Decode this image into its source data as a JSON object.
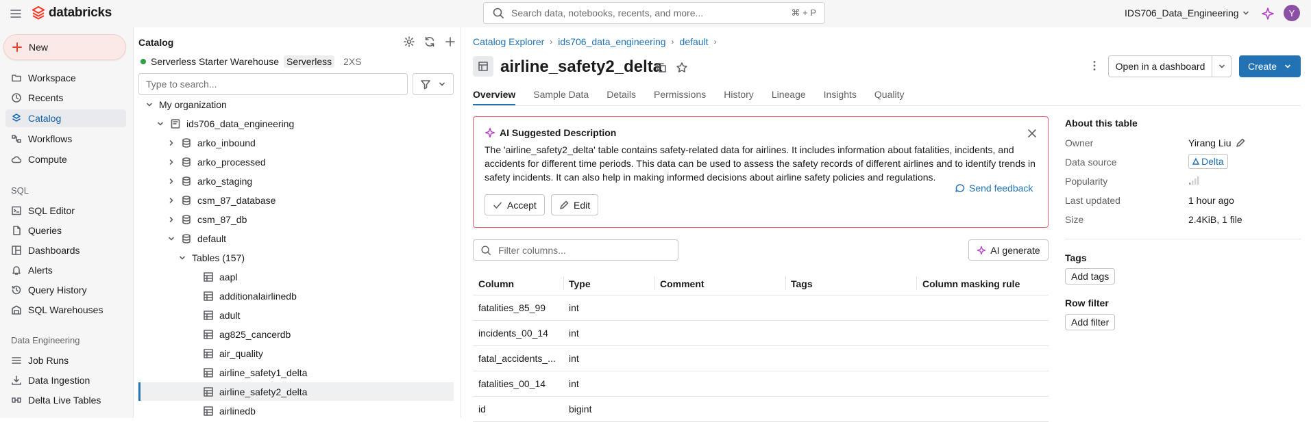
{
  "topbar": {
    "logo_text": "databricks",
    "search_placeholder": "Search data, notebooks, recents, and more...",
    "search_shortcut": "⌘ + P",
    "workspace_name": "IDS706_Data_Engineering",
    "avatar_initial": "Y"
  },
  "sidebar": {
    "new_label": "New",
    "items": [
      {
        "label": "Workspace",
        "icon": "folder-icon"
      },
      {
        "label": "Recents",
        "icon": "clock-icon"
      },
      {
        "label": "Catalog",
        "icon": "catalog-icon"
      },
      {
        "label": "Workflows",
        "icon": "workflows-icon"
      },
      {
        "label": "Compute",
        "icon": "cloud-icon"
      }
    ],
    "sql_section": "SQL",
    "sql_items": [
      {
        "label": "SQL Editor",
        "icon": "sql-editor-icon"
      },
      {
        "label": "Queries",
        "icon": "queries-icon"
      },
      {
        "label": "Dashboards",
        "icon": "dashboards-icon"
      },
      {
        "label": "Alerts",
        "icon": "bell-icon"
      },
      {
        "label": "Query History",
        "icon": "history-icon"
      },
      {
        "label": "SQL Warehouses",
        "icon": "warehouse-icon"
      }
    ],
    "de_section": "Data Engineering",
    "de_items": [
      {
        "label": "Job Runs",
        "icon": "job-runs-icon"
      },
      {
        "label": "Data Ingestion",
        "icon": "ingestion-icon"
      },
      {
        "label": "Delta Live Tables",
        "icon": "pipeline-icon"
      }
    ]
  },
  "catalog": {
    "title": "Catalog",
    "warehouse": "Serverless Starter Warehouse",
    "warehouse_type": "Serverless",
    "warehouse_size": "2XS",
    "search_placeholder": "Type to search...",
    "tree": [
      "My organization",
      "ids706_data_engineering",
      "arko_inbound",
      "arko_processed",
      "arko_staging",
      "csm_87_database",
      "csm_87_db",
      "default",
      "Tables (157)",
      "aapl",
      "additionalairlinedb",
      "adult",
      "ag825_cancerdb",
      "air_quality",
      "airline_safety1_delta",
      "airline_safety2_delta",
      "airlinedb"
    ]
  },
  "main": {
    "breadcrumbs": [
      "Catalog Explorer",
      "ids706_data_engineering",
      "default"
    ],
    "table_name": "airline_safety2_delta",
    "open_dashboard": "Open in a dashboard",
    "create": "Create",
    "tabs": [
      "Overview",
      "Sample Data",
      "Details",
      "Permissions",
      "History",
      "Lineage",
      "Insights",
      "Quality"
    ],
    "ai": {
      "title": "AI Suggested Description",
      "text": "The 'airline_safety2_delta' table contains safety-related data for airlines. It includes information about fatalities, incidents, and accidents for different time periods. This data can be used to assess the safety records of different airlines and to identify trends in safety incidents. It can also help in making informed decisions about airline safety policies and regulations.",
      "accept": "Accept",
      "edit": "Edit",
      "feedback": "Send feedback"
    },
    "filter_placeholder": "Filter columns...",
    "ai_generate": "AI generate",
    "columns_header": [
      "Column",
      "Type",
      "Comment",
      "Tags",
      "Column masking rule"
    ],
    "rows": [
      {
        "column": "fatalities_85_99",
        "type": "int"
      },
      {
        "column": "incidents_00_14",
        "type": "int"
      },
      {
        "column": "fatal_accidents_...",
        "type": "int"
      },
      {
        "column": "fatalities_00_14",
        "type": "int"
      },
      {
        "column": "id",
        "type": "bigint"
      }
    ]
  },
  "about": {
    "title": "About this table",
    "owner_label": "Owner",
    "owner": "Yirang Liu",
    "source_label": "Data source",
    "source": "Delta",
    "popularity_label": "Popularity",
    "updated_label": "Last updated",
    "updated": "1 hour ago",
    "size_label": "Size",
    "size": "2.4KiB, 1 file",
    "tags_title": "Tags",
    "add_tags": "Add tags",
    "row_filter_title": "Row filter",
    "add_filter": "Add filter"
  },
  "colors": {
    "accent": "#2272b4",
    "ai_border": "#e35d6a",
    "sparkle": "#b03ec2"
  }
}
